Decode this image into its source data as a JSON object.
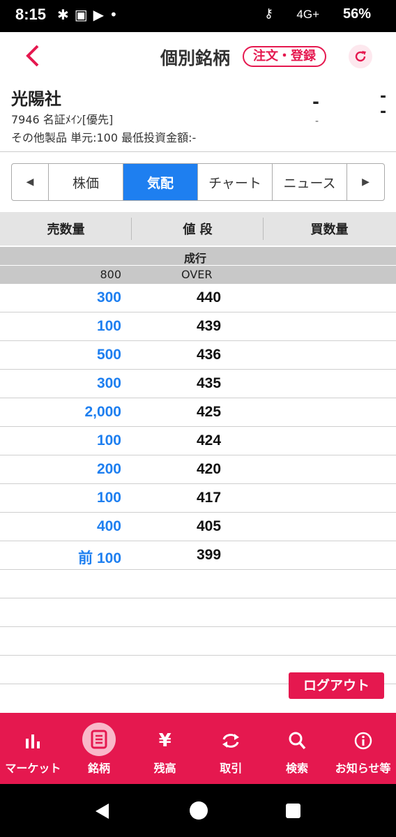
{
  "status_bar": {
    "time": "8:15",
    "network": "4G+",
    "battery": "56%"
  },
  "header": {
    "title": "個別銘柄",
    "order_label": "注文・登録"
  },
  "stock": {
    "name": "光陽社",
    "code_line": "7946 名証ﾒｲﾝ[優先]",
    "detail_line": "その他製品 単元:100 最低投資金額:-",
    "price": "-",
    "change_a": "-",
    "change_b": "-",
    "sub": "-"
  },
  "tabs": [
    {
      "label": "◀"
    },
    {
      "label": "株価"
    },
    {
      "label": "気配"
    },
    {
      "label": "チャート"
    },
    {
      "label": "ニュース"
    },
    {
      "label": "▶"
    }
  ],
  "board": {
    "headers": [
      "売数量",
      "値 段",
      "買数量"
    ],
    "market_label": "成行",
    "over_qty": "800",
    "over_label": "OVER",
    "rows": [
      {
        "qty": "300",
        "price": "440"
      },
      {
        "qty": "100",
        "price": "439"
      },
      {
        "qty": "500",
        "price": "436"
      },
      {
        "qty": "300",
        "price": "435"
      },
      {
        "qty": "2,000",
        "price": "425"
      },
      {
        "qty": "100",
        "price": "424"
      },
      {
        "qty": "200",
        "price": "420"
      },
      {
        "qty": "100",
        "price": "417"
      },
      {
        "qty": "400",
        "price": "405"
      },
      {
        "qty": "前 100",
        "price": "399"
      },
      {
        "qty": "",
        "price": ""
      },
      {
        "qty": "",
        "price": ""
      },
      {
        "qty": "",
        "price": ""
      },
      {
        "qty": "",
        "price": ""
      }
    ]
  },
  "logout_label": "ログアウト",
  "bottom_nav": [
    {
      "label": "マーケット",
      "icon": "bar-chart-icon"
    },
    {
      "label": "銘柄",
      "icon": "list-document-icon"
    },
    {
      "label": "残高",
      "icon": "yen-icon"
    },
    {
      "label": "取引",
      "icon": "exchange-icon"
    },
    {
      "label": "検索",
      "icon": "search-icon"
    },
    {
      "label": "お知らせ等",
      "icon": "info-icon"
    }
  ],
  "colors": {
    "accent": "#e5184f",
    "active_tab": "#1e7ff0",
    "qty": "#1e7ff0"
  }
}
